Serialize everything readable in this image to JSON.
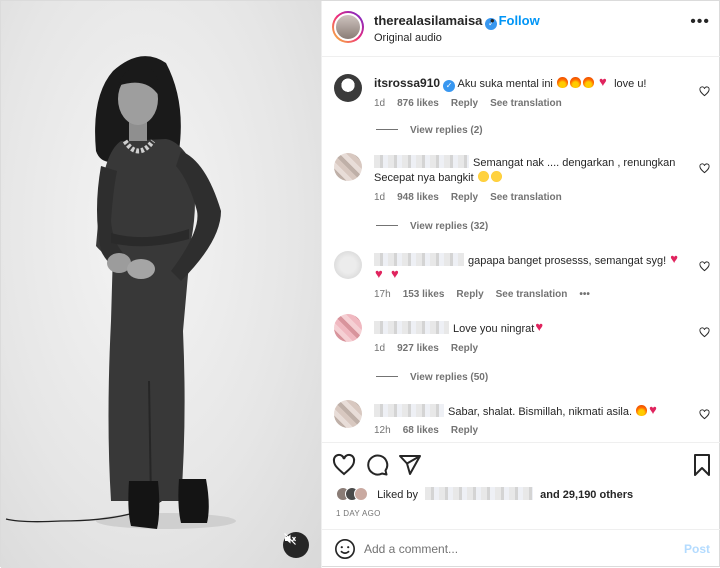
{
  "header": {
    "username": "therealasilamaisa",
    "follow_label": "Follow",
    "audio": "Original audio",
    "more": "•••"
  },
  "comments": [
    {
      "username": "itsrossa910",
      "text": "Aku suka mental ini",
      "suffix": "love u!",
      "time": "1d",
      "likes": "876 likes",
      "reply": "Reply",
      "translate": "See translation",
      "view_replies": "View replies (2)"
    },
    {
      "text": "Semangat nak .... dengarkan , renungkan",
      "text2": "Secepat nya bangkit",
      "time": "1d",
      "likes": "948 likes",
      "reply": "Reply",
      "translate": "See translation",
      "view_replies": "View replies (32)"
    },
    {
      "text": "gapapa banget prosesss, semangat syg!",
      "time": "17h",
      "likes": "153 likes",
      "reply": "Reply",
      "translate": "See translation",
      "more": "•••"
    },
    {
      "text": "Love you ningrat",
      "time": "1d",
      "likes": "927 likes",
      "reply": "Reply",
      "view_replies": "View replies (50)"
    },
    {
      "text": "Sabar, shalat. Bismillah, nikmati asila.",
      "time": "12h",
      "likes": "68 likes",
      "reply": "Reply"
    }
  ],
  "actions": {
    "liked_by": "Liked by",
    "and_others": "and 29,190 others",
    "time_ago": "1 DAY AGO"
  },
  "add_comment": {
    "placeholder": "Add a comment...",
    "post_label": "Post"
  },
  "icons": [
    "heart-icon",
    "comment-icon",
    "share-icon",
    "bookmark-icon",
    "emoji-icon",
    "mute-icon",
    "verified-icon"
  ],
  "colors": {
    "link": "#0095f6",
    "post_disabled": "#b3dbff",
    "verified": "#3897f0",
    "heart": "#e0245e"
  }
}
